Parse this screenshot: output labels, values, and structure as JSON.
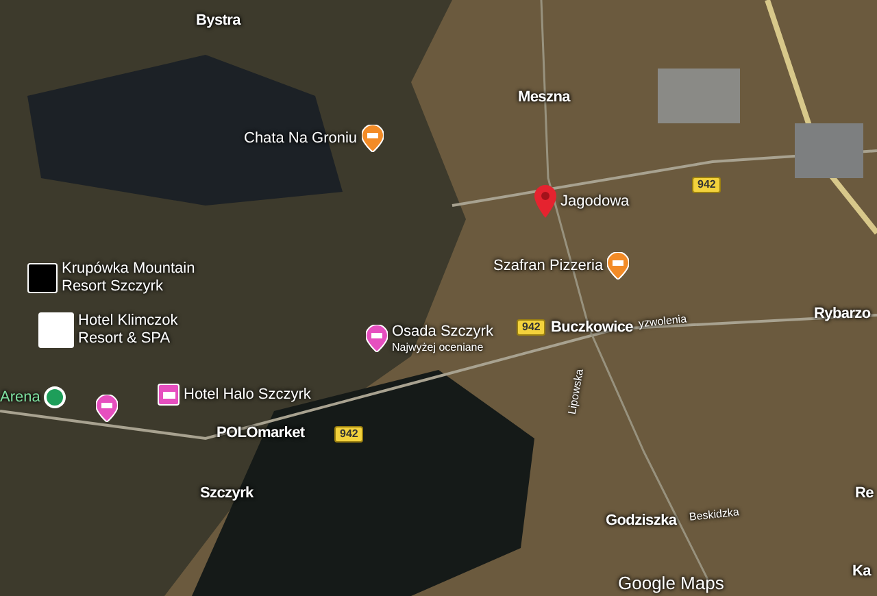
{
  "map": {
    "labels": [
      {
        "kind": "place",
        "text": "Bystra"
      },
      {
        "kind": "place",
        "text": "Meszna"
      },
      {
        "kind": "restaurant",
        "text": "Chata Na Groniu"
      },
      {
        "kind": "pin",
        "text": "Jagodowa"
      },
      {
        "kind": "road",
        "text": "942"
      },
      {
        "kind": "restaurant",
        "text": "Szafran Pizzeria"
      },
      {
        "kind": "logo_dark",
        "text": "Krupówka Mountain\nResort Szczyrk"
      },
      {
        "kind": "logo_light",
        "text": "Hotel Klimczok\nResort & SPA"
      },
      {
        "kind": "hotel",
        "text": "Osada Szczyrk",
        "subtitle": "Najwyżej oceniane"
      },
      {
        "kind": "road",
        "text": "942"
      },
      {
        "kind": "place",
        "text": "Buczkowice"
      },
      {
        "kind": "street",
        "text": "yzwolenia"
      },
      {
        "kind": "place",
        "text": "Rybarzo"
      },
      {
        "kind": "street_vertical",
        "text": "Lipowska"
      },
      {
        "kind": "attraction",
        "text": "Arena"
      },
      {
        "kind": "hotel"
      },
      {
        "kind": "hotel_square",
        "text": "Hotel Halo Szczyrk"
      },
      {
        "kind": "place",
        "text": "POLOmarket"
      },
      {
        "kind": "road",
        "text": "942"
      },
      {
        "kind": "place",
        "text": "Szczyrk"
      },
      {
        "kind": "place",
        "text": "Godziszka"
      },
      {
        "kind": "street",
        "text": "Beskidzka"
      },
      {
        "kind": "place",
        "text": "Re"
      },
      {
        "kind": "place",
        "text": "Ka"
      },
      {
        "kind": "brand",
        "text": "Google Maps"
      }
    ]
  }
}
